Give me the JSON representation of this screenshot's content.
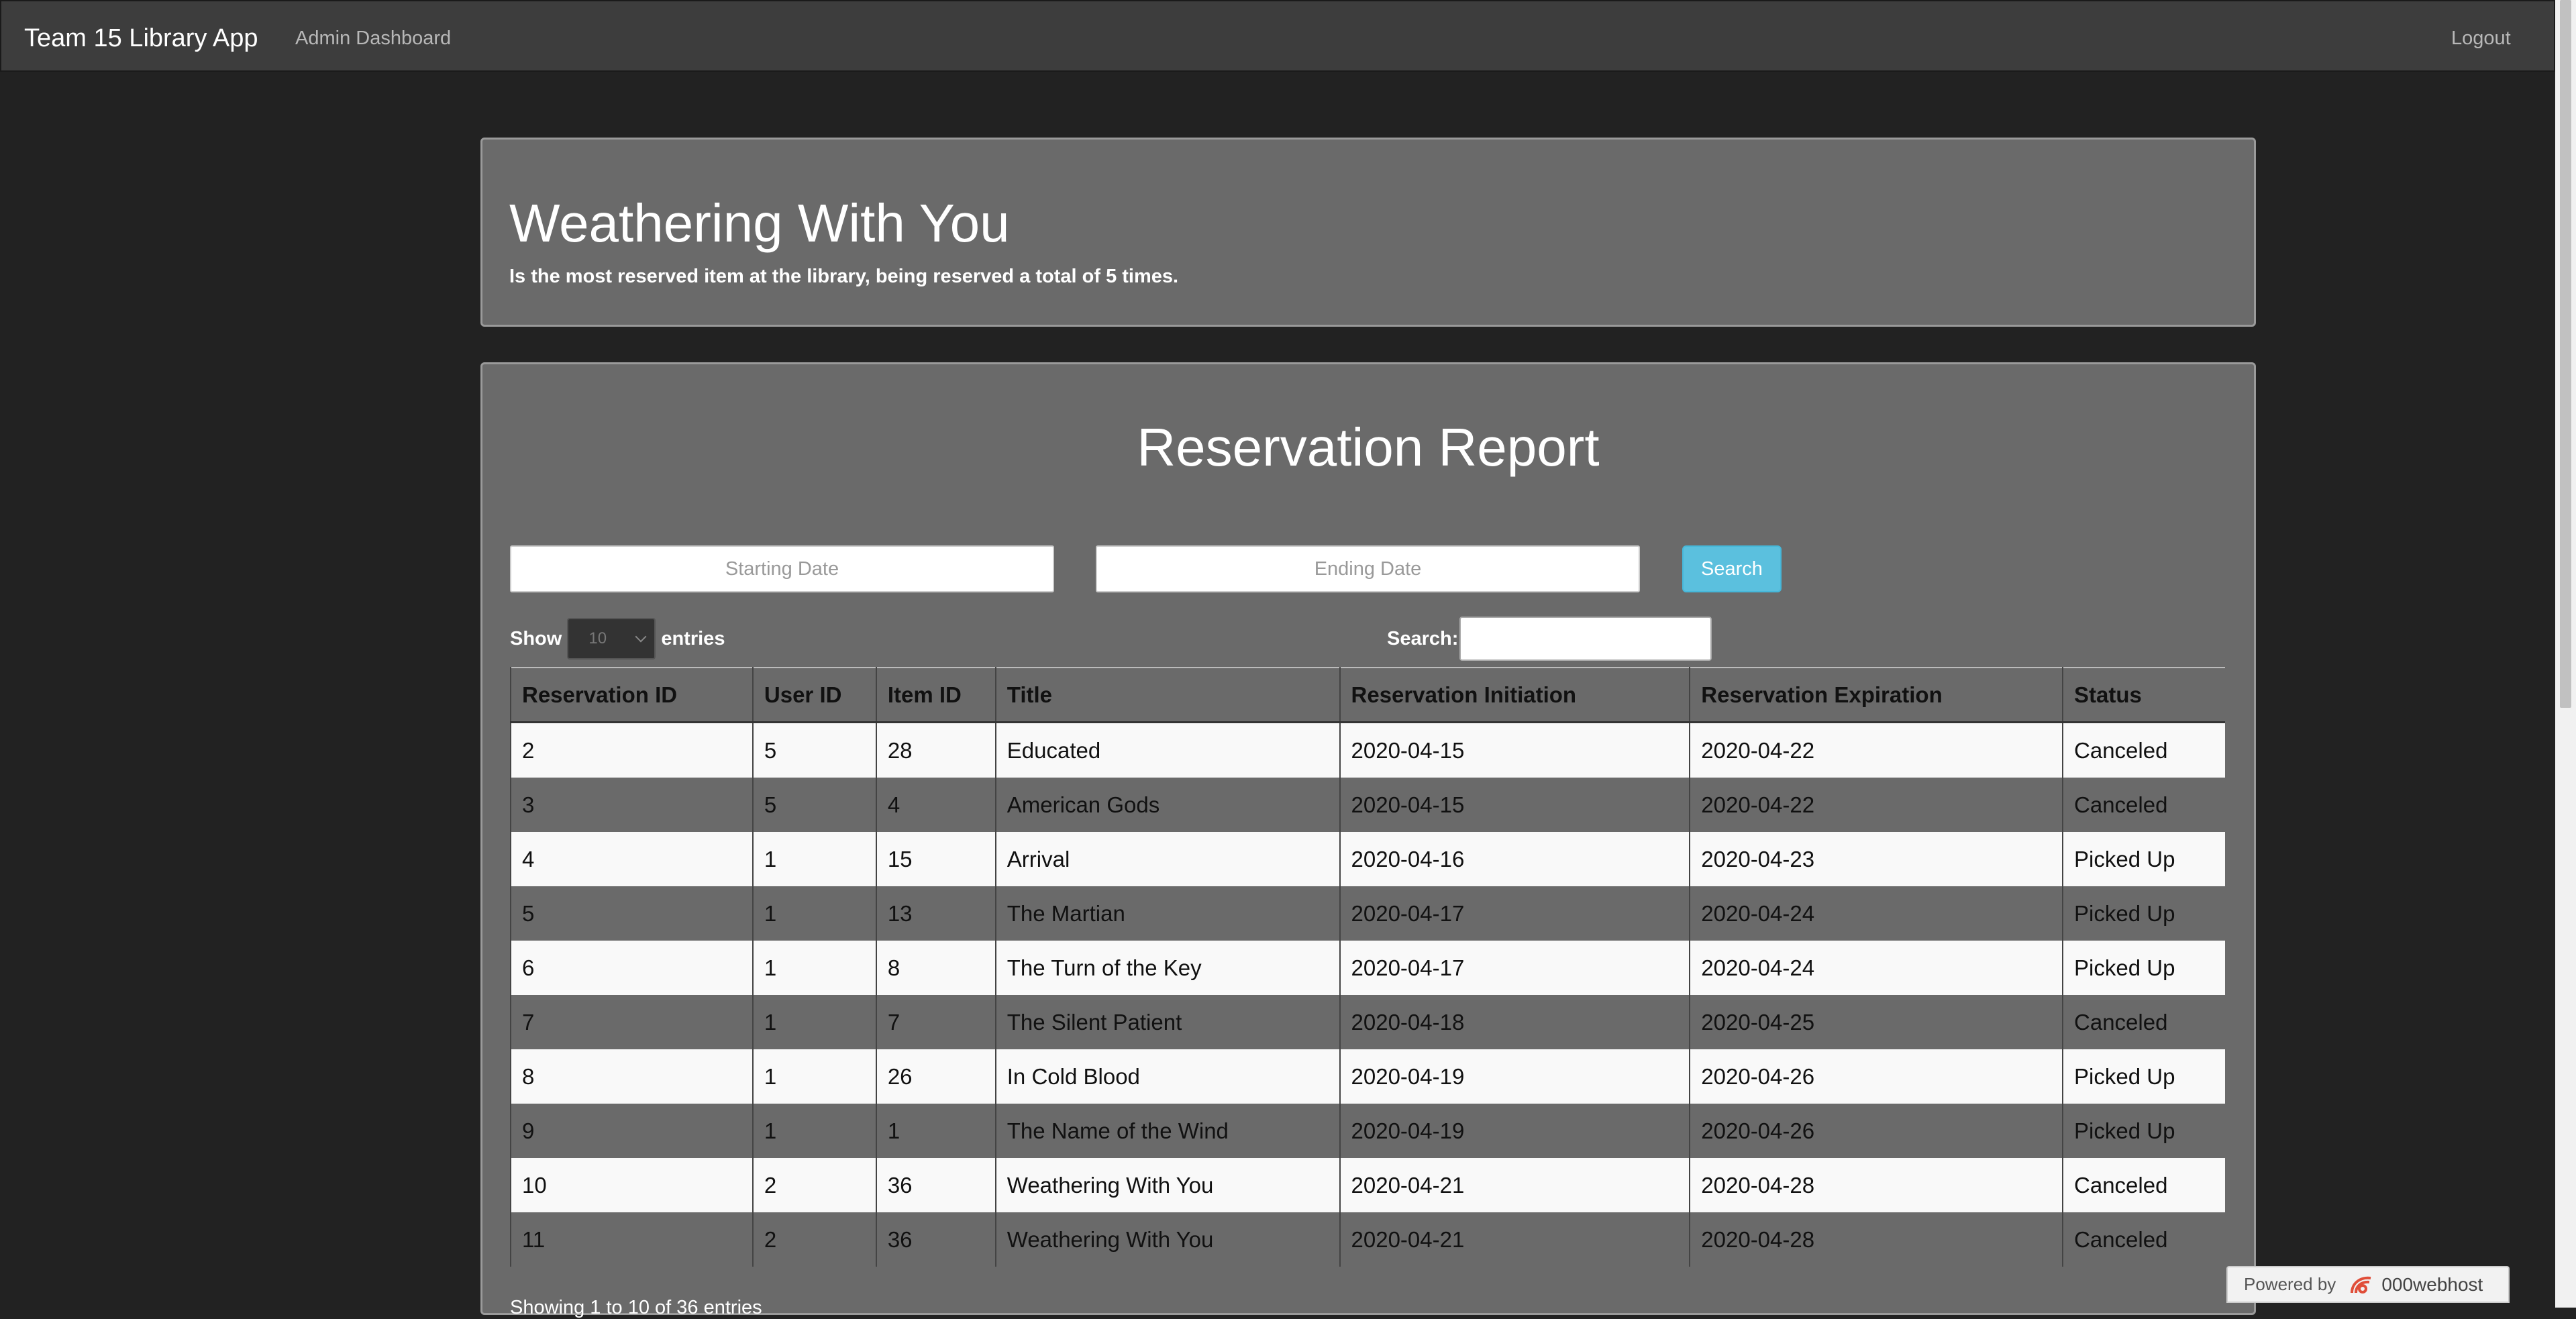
{
  "navbar": {
    "brand": "Team 15 Library App",
    "admin_link": "Admin Dashboard",
    "logout": "Logout"
  },
  "hero": {
    "title": "Weathering With You",
    "subtitle": "Is the most reserved item at the library, being reserved a total of 5 times."
  },
  "report": {
    "title": "Reservation Report",
    "start_placeholder": "Starting Date",
    "end_placeholder": "Ending Date",
    "search_button": "Search",
    "show_label": "Show",
    "entries_label": "entries",
    "length_value": "10",
    "search_label": "Search:",
    "search_value": "",
    "info": "Showing 1 to 10 of 36 entries"
  },
  "table": {
    "columns": [
      "Reservation ID",
      "User ID",
      "Item ID",
      "Title",
      "Reservation Initiation",
      "Reservation Expiration",
      "Status"
    ],
    "rows": [
      [
        "2",
        "5",
        "28",
        "Educated",
        "2020-04-15",
        "2020-04-22",
        "Canceled"
      ],
      [
        "3",
        "5",
        "4",
        "American Gods",
        "2020-04-15",
        "2020-04-22",
        "Canceled"
      ],
      [
        "4",
        "1",
        "15",
        "Arrival",
        "2020-04-16",
        "2020-04-23",
        "Picked Up"
      ],
      [
        "5",
        "1",
        "13",
        "The Martian",
        "2020-04-17",
        "2020-04-24",
        "Picked Up"
      ],
      [
        "6",
        "1",
        "8",
        "The Turn of the Key",
        "2020-04-17",
        "2020-04-24",
        "Picked Up"
      ],
      [
        "7",
        "1",
        "7",
        "The Silent Patient",
        "2020-04-18",
        "2020-04-25",
        "Canceled"
      ],
      [
        "8",
        "1",
        "26",
        "In Cold Blood",
        "2020-04-19",
        "2020-04-26",
        "Picked Up"
      ],
      [
        "9",
        "1",
        "1",
        "The Name of the Wind",
        "2020-04-19",
        "2020-04-26",
        "Picked Up"
      ],
      [
        "10",
        "2",
        "36",
        "Weathering With You",
        "2020-04-21",
        "2020-04-28",
        "Canceled"
      ],
      [
        "11",
        "2",
        "36",
        "Weathering With You",
        "2020-04-21",
        "2020-04-28",
        "Canceled"
      ]
    ]
  },
  "badge": {
    "powered_by": "Powered by",
    "brand": "000webhost"
  },
  "colors": {
    "background": "#222222",
    "navbar": "#3d3d3d",
    "card": "#6a6a6a",
    "accent_button": "#5bc0de",
    "row_light": "#f9f9f9",
    "row_dark": "#6a6a6a",
    "webhost_logo": "#e04e39"
  }
}
